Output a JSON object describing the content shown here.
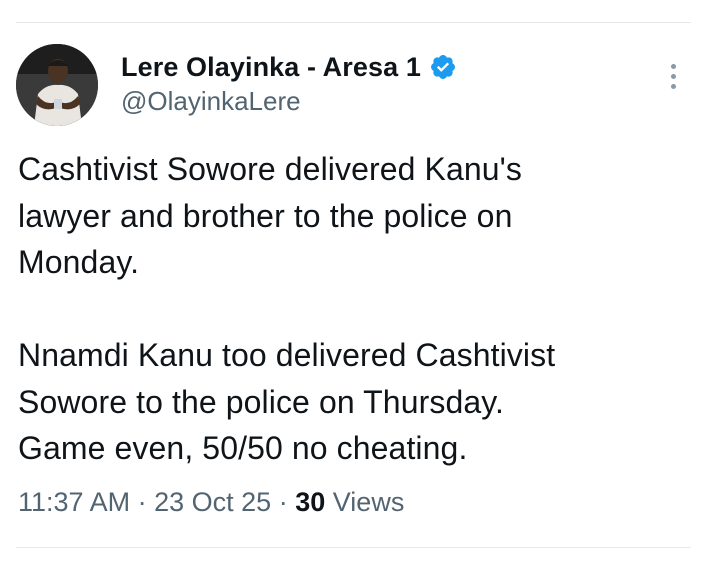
{
  "author": {
    "display_name": "Lere Olayinka - Aresa 1",
    "handle": "@OlayinkaLere",
    "verified": true
  },
  "tweet": {
    "paragraph_1": "Cashtivist Sowore delivered Kanu's\nlawyer and brother to the police on\nMonday.",
    "paragraph_2": "Nnamdi Kanu too delivered Cashtivist\nSowore to the police on Thursday.\nGame even,  50/50 no cheating."
  },
  "meta": {
    "time": "11:37 AM",
    "separator": "·",
    "date": "23 Oct 25",
    "views_count": "30",
    "views_label": "Views"
  },
  "icons": {
    "verified": "verified-badge-icon",
    "more": "more-options-icon"
  },
  "colors": {
    "text_primary": "#0f1419",
    "text_secondary": "#536471",
    "verified_blue": "#1d9bf0",
    "divider": "#e6e9ec"
  }
}
